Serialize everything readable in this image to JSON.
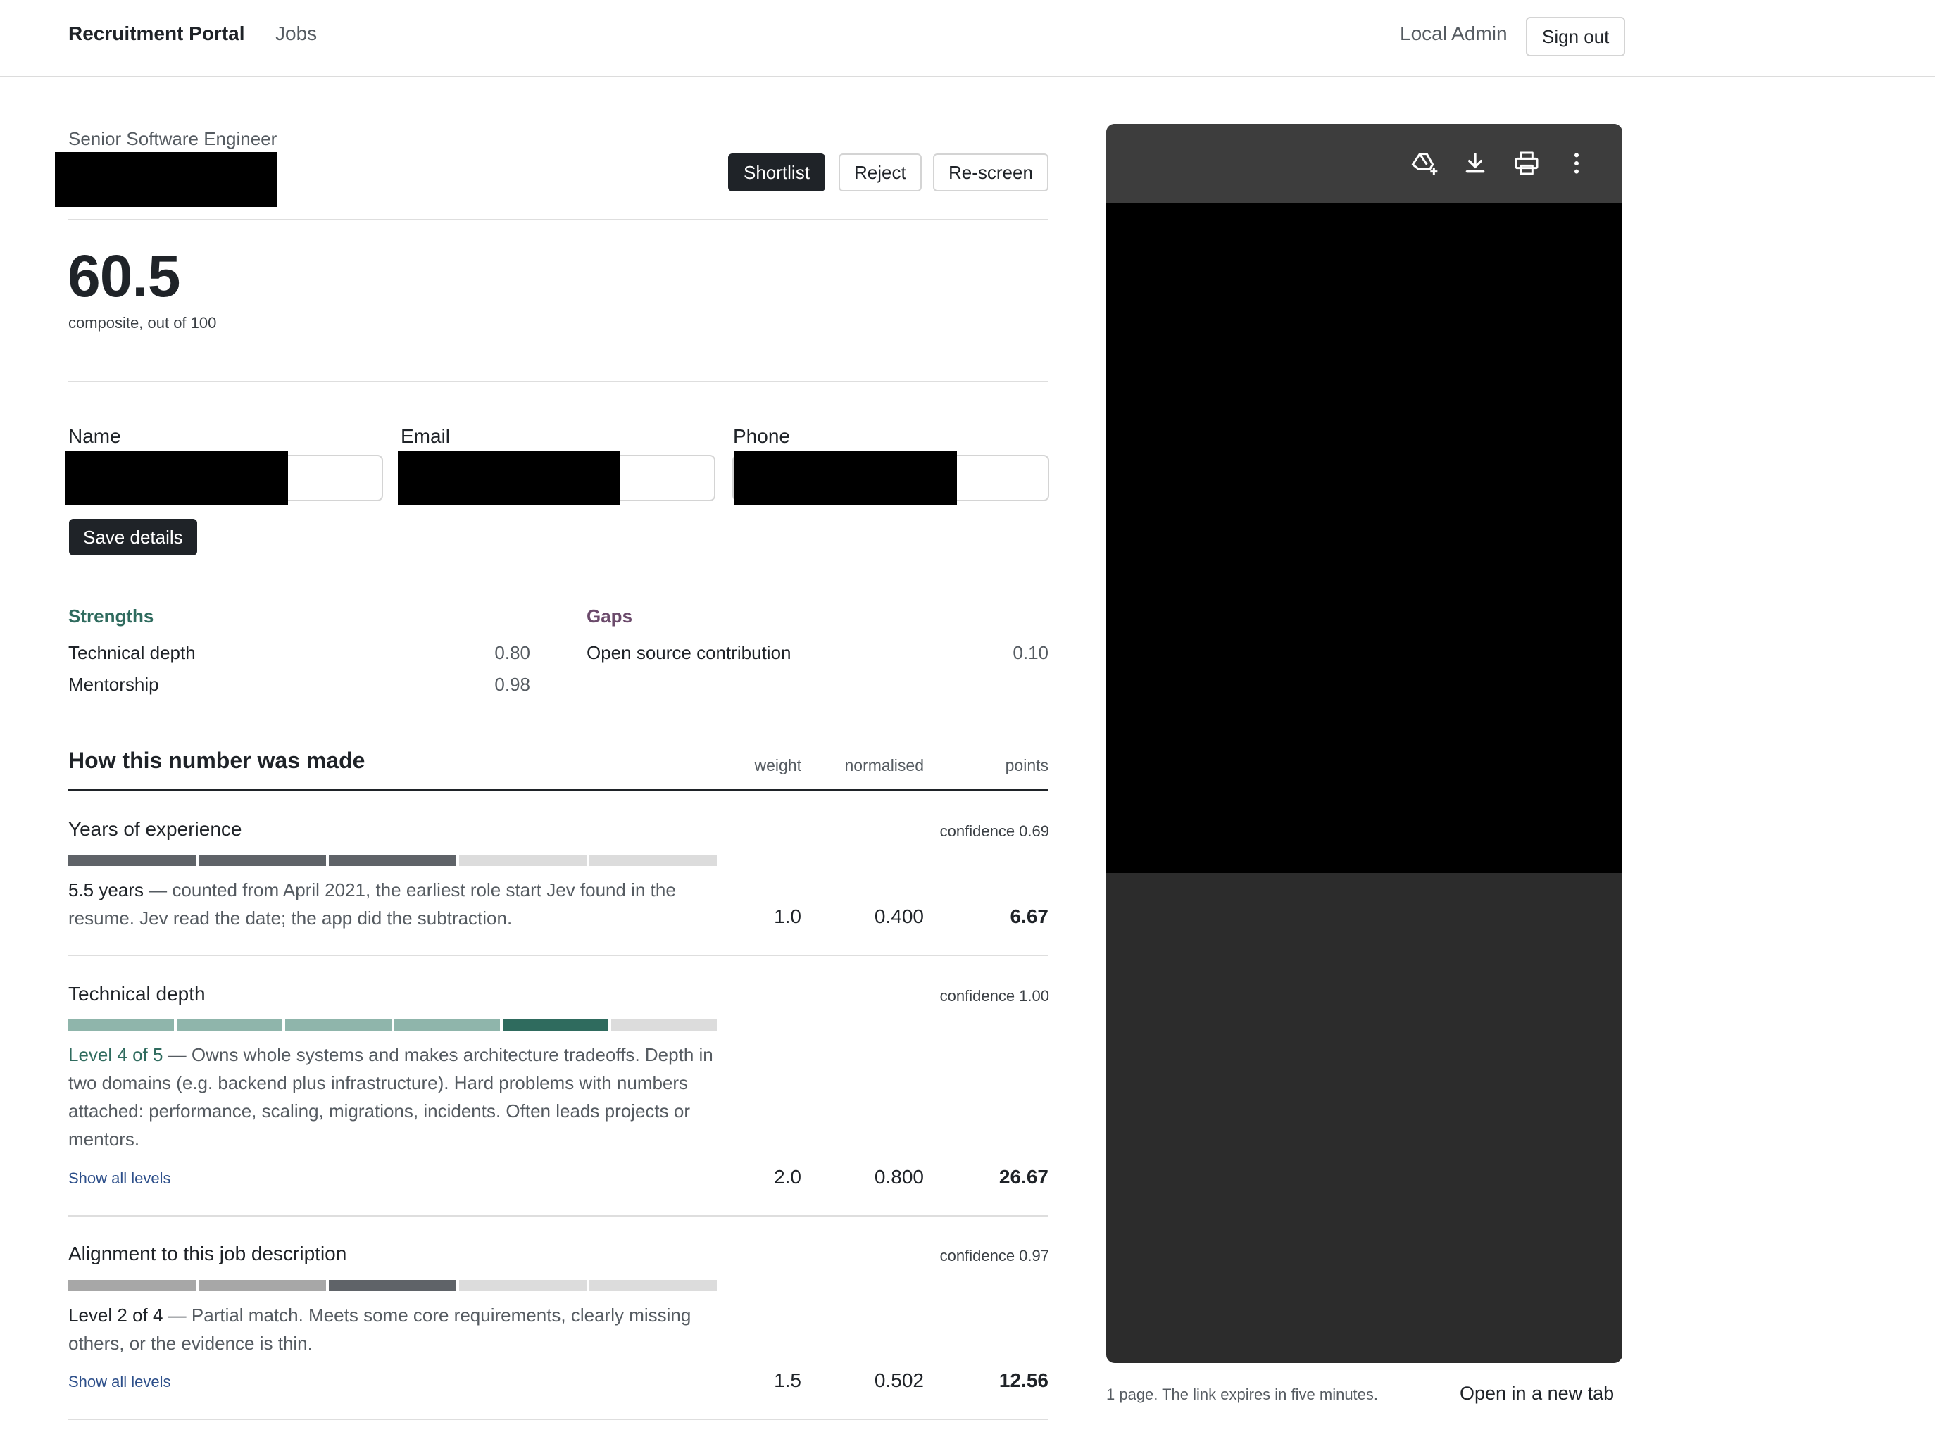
{
  "nav": {
    "brand": "Recruitment Portal",
    "jobs": "Jobs",
    "user": "Local Admin",
    "signout": "Sign out"
  },
  "candidate": {
    "job_title": "Senior Software Engineer",
    "actions": {
      "shortlist": "Shortlist",
      "reject": "Reject",
      "rescreen": "Re-screen"
    },
    "score": "60.5",
    "score_sub": "composite, out of 100"
  },
  "details": {
    "name_label": "Name",
    "email_label": "Email",
    "phone_label": "Phone",
    "save": "Save details"
  },
  "strengths": {
    "title": "Strengths",
    "color": "#2f6b5e",
    "items": [
      {
        "label": "Technical depth",
        "value": "0.80"
      },
      {
        "label": "Mentorship",
        "value": "0.98"
      }
    ]
  },
  "gaps": {
    "title": "Gaps",
    "color": "#6b4a6b",
    "items": [
      {
        "label": "Open source contribution",
        "value": "0.10"
      }
    ]
  },
  "breakdown": {
    "title": "How this number was made",
    "columns": {
      "weight": "weight",
      "normalised": "normalised",
      "points": "points"
    },
    "criteria": [
      {
        "title": "Years of experience",
        "confidence": "confidence 0.69",
        "level_filled": 3,
        "level_total": 5,
        "lead": "5.5 years",
        "text": " — counted from April 2021, the earliest role start Jev found in the resume. Jev read the date; the app did the subtraction.",
        "weight": "1.0",
        "normalised": "0.400",
        "points": "6.67"
      },
      {
        "title": "Technical depth",
        "confidence": "confidence 1.00",
        "level_filled": 5,
        "level_total": 6,
        "lead": "Level 4 of 5",
        "text": " — Owns whole systems and makes architecture tradeoffs. Depth in two domains (e.g. backend plus infrastructure). Hard problems with numbers attached: performance, scaling, migrations, incidents. Often leads projects or mentors.",
        "show_all": "Show all levels",
        "weight": "2.0",
        "normalised": "0.800",
        "points": "26.67"
      },
      {
        "title": "Alignment to this job description",
        "confidence": "confidence 0.97",
        "level_filled": 3,
        "level_total": 5,
        "lead": "Level 2 of 4",
        "text": " — Partial match. Meets some core requirements, clearly missing others, or the evidence is thin.",
        "show_all": "Show all levels",
        "weight": "1.5",
        "normalised": "0.502",
        "points": "12.56"
      }
    ]
  },
  "viewer": {
    "icons": [
      "add-to-drive-icon",
      "download-icon",
      "print-icon",
      "more-vert-icon"
    ],
    "note": "1 page. The link expires in five minutes.",
    "open_tab": "Open in a new tab"
  }
}
